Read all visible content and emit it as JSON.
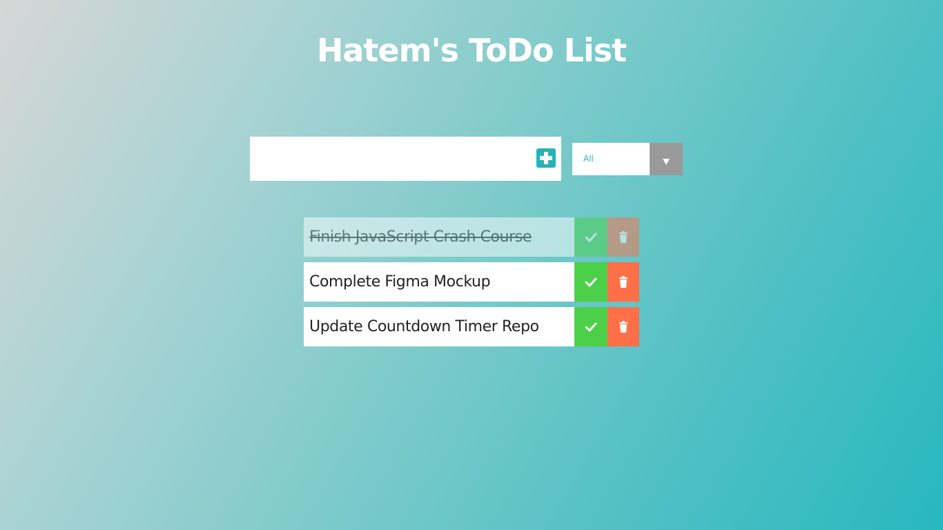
{
  "header": {
    "title": "Hatem's ToDo List"
  },
  "form": {
    "input_value": "",
    "input_placeholder": "",
    "add_icon": "plus-square-icon",
    "filter_selected": "All",
    "filter_icon": "caret-down-icon"
  },
  "todos": [
    {
      "text": "Finish JavaScript Crash Course",
      "completed": true
    },
    {
      "text": "Complete Figma Mockup",
      "completed": false
    },
    {
      "text": "Update Countdown Timer Repo",
      "completed": false
    }
  ],
  "colors": {
    "accent": "#27b2b8",
    "check": "#4cd04a",
    "trash": "#ff7048",
    "select_arrow_bg": "#9a9a9a"
  }
}
